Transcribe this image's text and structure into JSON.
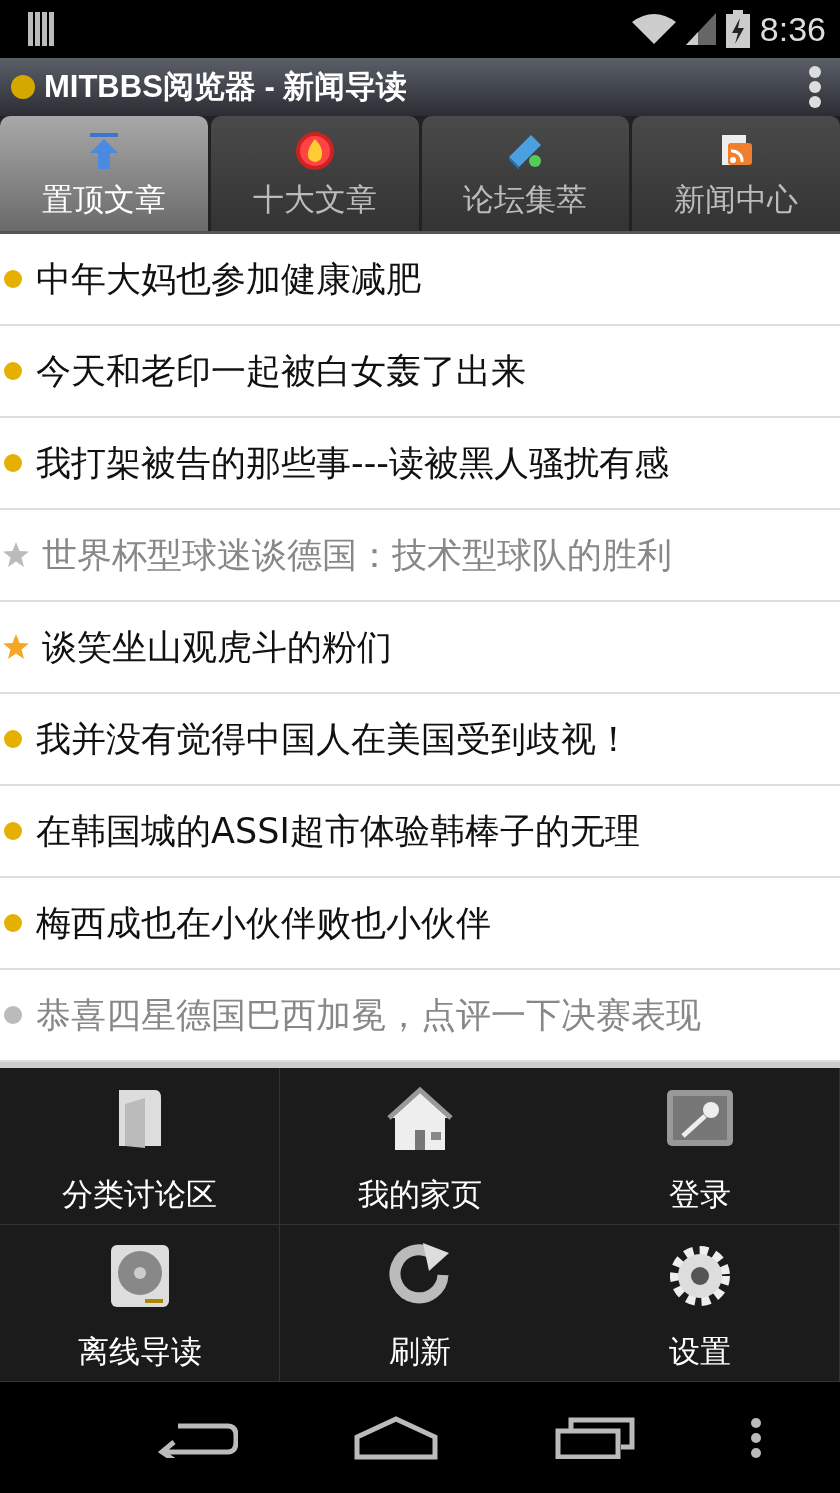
{
  "status_bar": {
    "time": "8:36"
  },
  "title_bar": {
    "title": "MITBBS阅览器 - 新闻导读"
  },
  "tabs": [
    {
      "label": "置顶文章",
      "selected": true
    },
    {
      "label": "十大文章",
      "selected": false
    },
    {
      "label": "论坛集萃",
      "selected": false
    },
    {
      "label": "新闻中心",
      "selected": false
    }
  ],
  "articles": [
    {
      "title": "中年大妈也参加健康减肥",
      "kind": "dot",
      "read": false
    },
    {
      "title": "今天和老印一起被白女轰了出来",
      "kind": "dot",
      "read": false
    },
    {
      "title": "我打架被告的那些事---读被黑人骚扰有感",
      "kind": "dot",
      "read": false
    },
    {
      "title": "世界杯型球迷谈德国：技术型球队的胜利",
      "kind": "star",
      "read": true
    },
    {
      "title": "谈笑坐山观虎斗的粉们",
      "kind": "star",
      "read": false
    },
    {
      "title": "我并没有觉得中国人在美国受到歧视！",
      "kind": "dot",
      "read": false
    },
    {
      "title": "在韩国城的ASSI超市体验韩棒子的无理",
      "kind": "dot",
      "read": false
    },
    {
      "title": "梅西成也在小伙伴败也小伙伴",
      "kind": "dot",
      "read": false
    },
    {
      "title": "恭喜四星德国巴西加冕，点评一下决赛表现",
      "kind": "dot",
      "read": true
    }
  ],
  "menu": [
    {
      "label": "分类讨论区"
    },
    {
      "label": "我的家页"
    },
    {
      "label": "登录"
    },
    {
      "label": "离线导读"
    },
    {
      "label": "刷新"
    },
    {
      "label": "设置"
    }
  ]
}
